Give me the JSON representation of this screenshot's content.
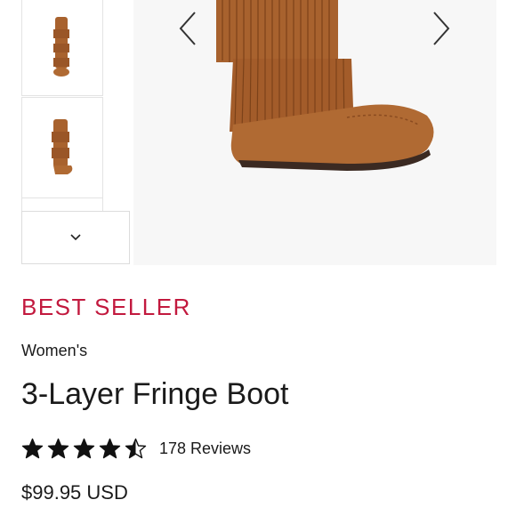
{
  "gallery": {
    "thumbnails": [
      {
        "alt": "boot-thumbnail-front",
        "icon": "boot-image"
      },
      {
        "alt": "boot-thumbnail-side",
        "icon": "boot-image"
      }
    ],
    "more_icon": "chevron-down-icon",
    "prev_icon": "chevron-left-icon",
    "next_icon": "chevron-right-icon"
  },
  "product": {
    "badge": "BEST SELLER",
    "category": "Women's",
    "name": "3-Layer Fringe Boot",
    "rating": 4.5,
    "rating_max": 5,
    "reviews_label": "178 Reviews",
    "price": "$99.95 USD"
  },
  "colors": {
    "badge": "#c2193e",
    "suede": "#a8622e",
    "text": "#1a1a1a"
  }
}
